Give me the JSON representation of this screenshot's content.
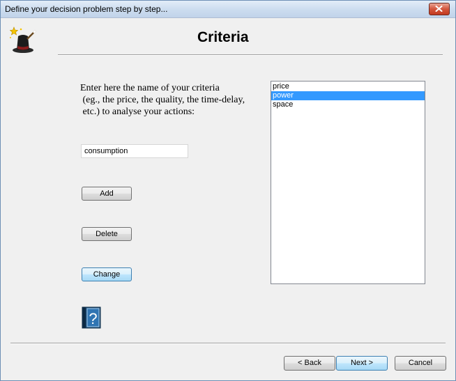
{
  "window": {
    "title": "Define your decision problem step by step..."
  },
  "header": {
    "title": "Criteria"
  },
  "instructions": {
    "line1": "Enter here the name of your criteria",
    "line2": " (eg., the price, the quality, the time-delay,",
    "line3": " etc.) to analyse your actions:"
  },
  "criterion_input": {
    "value": "consumption"
  },
  "actions": {
    "add_label": "Add",
    "delete_label": "Delete",
    "change_label": "Change"
  },
  "criteria_list": {
    "items": [
      "price",
      "power",
      "space"
    ],
    "selected": "power"
  },
  "navigation": {
    "back_label": "< Back",
    "next_label": "Next >",
    "cancel_label": "Cancel"
  },
  "icons": {
    "wizard": "magic-hat-icon",
    "help": "help-book-icon",
    "close": "close-icon"
  },
  "colors": {
    "selection": "#3399ff",
    "close_button": "#c23a20"
  }
}
